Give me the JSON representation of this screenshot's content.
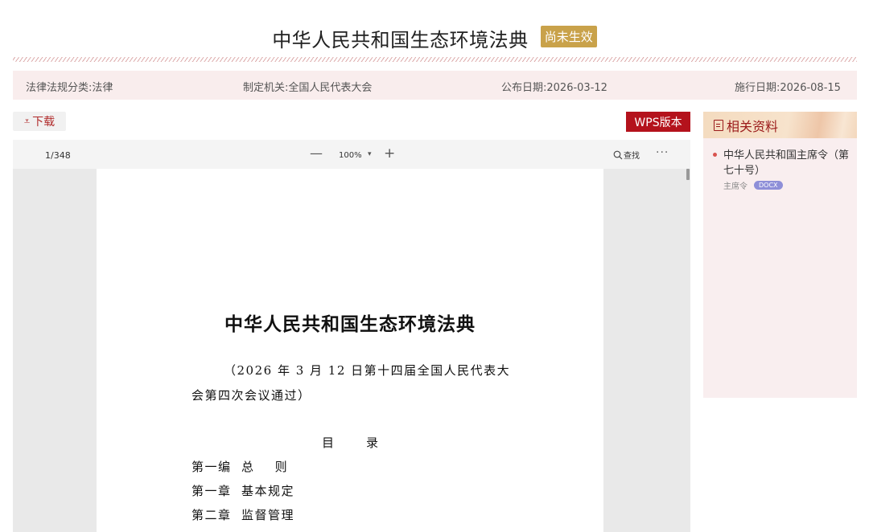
{
  "header": {
    "title": "中华人民共和国生态环境法典",
    "status_badge": "尚未生效"
  },
  "meta": {
    "category_label": "法律法规分类:",
    "category_value": "法律",
    "authority_label": "制定机关:",
    "authority_value": "全国人民代表大会",
    "publish_label": "公布日期:",
    "publish_value": "2026-03-12",
    "effective_label": "施行日期:",
    "effective_value": "2026-08-15"
  },
  "actions": {
    "download_icon": "⩡",
    "download_label": "下载",
    "wps_label": "WPS版本"
  },
  "viewer": {
    "page_indicator": "1/348",
    "zoom_minus": "—",
    "zoom_level": "100%",
    "zoom_caret": "▾",
    "zoom_plus": "+",
    "search_label": "查找",
    "more": "···"
  },
  "document": {
    "title": "中华人民共和国生态环境法典",
    "subtitle": "（2026 年 3 月 12 日第十四届全国人民代表大会第四次会议通过）",
    "toc_heading": "目录",
    "toc_items": [
      "第一编  总    则",
      "第一章  基本规定",
      "第二章  监督管理"
    ]
  },
  "related": {
    "header": "相关资料",
    "items": [
      {
        "title": "中华人民共和国主席令（第七十号）",
        "type": "主席令",
        "badge": "DOCX"
      }
    ]
  },
  "colors": {
    "accent_red": "#b4121c",
    "status_gold": "#c9a24a",
    "docx_badge": "#8e8fd8"
  }
}
